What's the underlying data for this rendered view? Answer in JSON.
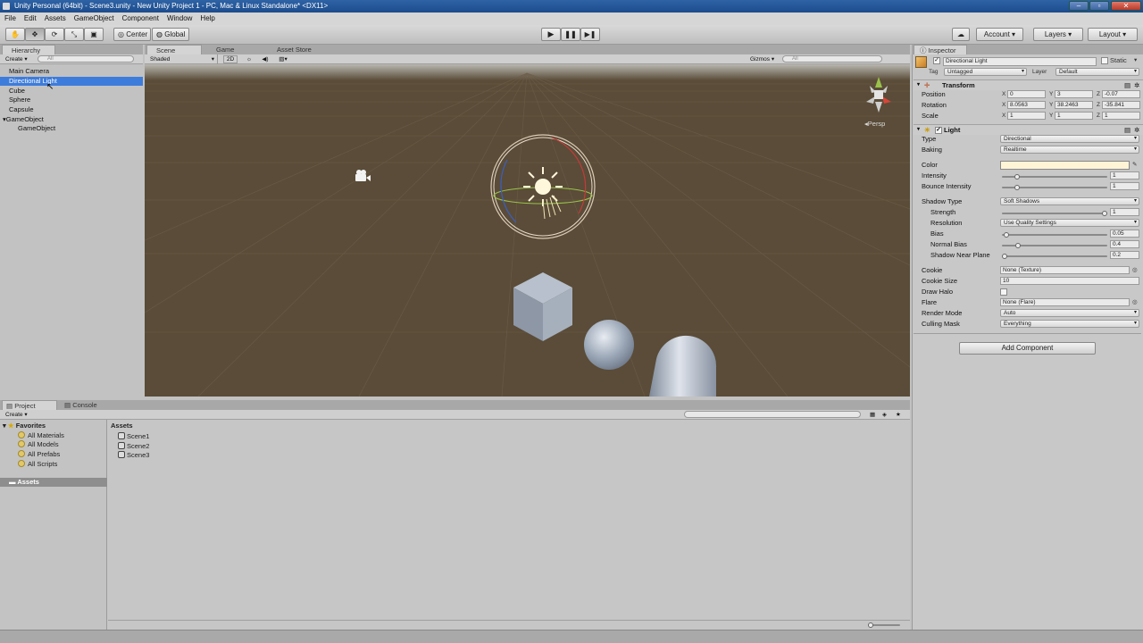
{
  "window": {
    "title": "Unity Personal (64bit) - Scene3.unity - New Unity Project 1 - PC, Mac & Linux Standalone* <DX11>"
  },
  "menu": [
    "File",
    "Edit",
    "Assets",
    "GameObject",
    "Component",
    "Window",
    "Help"
  ],
  "toolbar": {
    "pivot_label": "Center",
    "space_label": "Global",
    "account_label": "Account",
    "layers_label": "Layers",
    "layout_label": "Layout"
  },
  "hierarchy": {
    "tab": "Hierarchy",
    "create": "Create",
    "search_placeholder": "All",
    "items": [
      {
        "label": "Main Camera"
      },
      {
        "label": "Directional Light"
      },
      {
        "label": "Cube"
      },
      {
        "label": "Sphere"
      },
      {
        "label": "Capsule"
      },
      {
        "label": "GameObject"
      },
      {
        "label": "GameObject"
      }
    ]
  },
  "scene_tabs": {
    "scene": "Scene",
    "game": "Game",
    "store": "Asset Store"
  },
  "scene_bar": {
    "shading": "Shaded",
    "mode2d": "2D",
    "gizmos": "Gizmos",
    "search_placeholder": "All",
    "persp": "Persp"
  },
  "inspector": {
    "tab": "Inspector",
    "object_name": "Directional Light",
    "static_label": "Static",
    "tag_label": "Tag",
    "tag_value": "Untagged",
    "layer_label": "Layer",
    "layer_value": "Default",
    "transform": {
      "title": "Transform",
      "position_label": "Position",
      "pos_x": "0",
      "pos_y": "3",
      "pos_z": "-0.07",
      "rotation_label": "Rotation",
      "rot_x": "8.0563",
      "rot_y": "38.2463",
      "rot_z": "-35.841",
      "scale_label": "Scale",
      "scl_x": "1",
      "scl_y": "1",
      "scl_z": "1"
    },
    "light": {
      "title": "Light",
      "type_label": "Type",
      "type_value": "Directional",
      "baking_label": "Baking",
      "baking_value": "Realtime",
      "color_label": "Color",
      "color_value": "#fff4d6",
      "intensity_label": "Intensity",
      "intensity_value": "1",
      "intensity_fraction": 0.125,
      "bounce_label": "Bounce Intensity",
      "bounce_value": "1",
      "bounce_fraction": 0.125,
      "shadow_type_label": "Shadow Type",
      "shadow_type_value": "Soft Shadows",
      "strength_label": "Strength",
      "strength_value": "1",
      "strength_fraction": 1.0,
      "resolution_label": "Resolution",
      "resolution_value": "Use Quality Settings",
      "bias_label": "Bias",
      "bias_value": "0.05",
      "bias_fraction": 0.02,
      "normal_bias_label": "Normal Bias",
      "normal_bias_value": "0.4",
      "normal_bias_fraction": 0.13,
      "near_plane_label": "Shadow Near Plane",
      "near_plane_value": "0.2",
      "near_plane_fraction": 0.0,
      "cookie_label": "Cookie",
      "cookie_value": "None (Texture)",
      "cookie_size_label": "Cookie Size",
      "cookie_size_value": "10",
      "halo_label": "Draw Halo",
      "flare_label": "Flare",
      "flare_value": "None (Flare)",
      "render_mode_label": "Render Mode",
      "render_mode_value": "Auto",
      "culling_label": "Culling Mask",
      "culling_value": "Everything"
    },
    "add_component": "Add Component"
  },
  "project": {
    "tab_project": "Project",
    "tab_console": "Console",
    "create": "Create",
    "favorites_label": "Favorites",
    "favorites": [
      "All Materials",
      "All Models",
      "All Prefabs",
      "All Scripts"
    ],
    "assets_root": "Assets",
    "assets_header": "Assets",
    "files": [
      "Scene1",
      "Scene2",
      "Scene3"
    ]
  },
  "colors": {
    "selection": "#3d7cdb",
    "scene_ground": "#5a4c38",
    "panel": "#c2c2c2"
  }
}
